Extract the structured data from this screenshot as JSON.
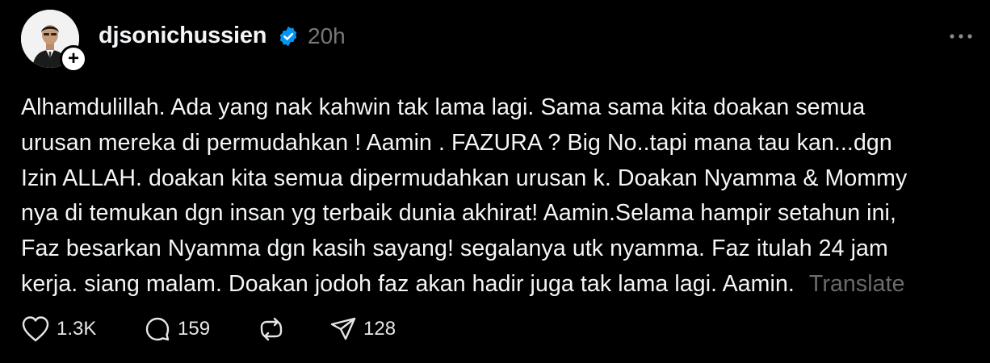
{
  "author": {
    "username": "djsonichussien",
    "verified": true,
    "time_ago": "20h",
    "follow_symbol": "+"
  },
  "post": {
    "lines": [
      "Alhamdulillah. Ada yang nak kahwin tak lama lagi. Sama sama kita doakan semua",
      "urusan mereka di permudahkan ! Aamin . FAZURA ? Big No..tapi mana tau kan...dgn",
      "Izin ALLAH. doakan kita semua dipermudahkan urusan k. Doakan Nyamma & Mommy",
      "nya di temukan dgn insan yg terbaik dunia akhirat! Aamin.Selama hampir setahun ini,",
      "Faz besarkan Nyamma dgn kasih sayang! segalanya utk nyamma. Faz itulah 24 jam",
      "kerja. siang malam. Doakan jodoh faz akan hadir juga tak lama lagi. Aamin."
    ],
    "translate_label": "Translate"
  },
  "actions": {
    "likes": "1.3K",
    "replies": "159",
    "shares": "128"
  },
  "colors": {
    "background": "#000000",
    "text": "#f3f5f7",
    "muted": "#777777",
    "verified": "#0095f6"
  }
}
